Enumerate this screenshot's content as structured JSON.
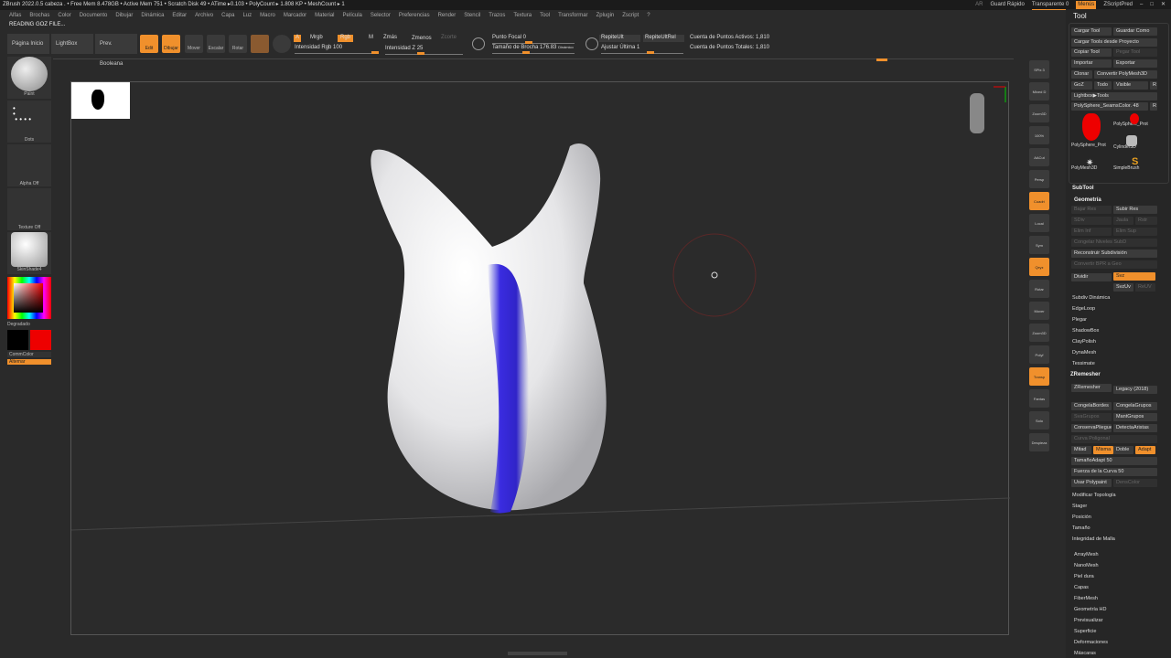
{
  "titlebar": {
    "text": "ZBrush 2022.0.5   cabeza   . • Free Mem 8.478GB • Active Mem 751 • Scratch Disk 49 •  ATime ▸0.103 • PolyCount ▸ 1.808 KP  • MeshCount ▸ 1",
    "ar": "AR",
    "quicksave": "Guard Rápido",
    "transparent": "Transparente 0",
    "menus": "Menús",
    "zscript": "ZScriptPred"
  },
  "menu": [
    "Alfas",
    "Brochas",
    "Color",
    "Documento",
    "Dibujar",
    "Dinámica",
    "Editar",
    "Archivo",
    "Capa",
    "Luz",
    "Macro",
    "Marcador",
    "Material",
    "Película",
    "Selector",
    "Preferencias",
    "Render",
    "Stencil",
    "Trazos",
    "Textura",
    "Tool",
    "Transformar",
    "Zplugin",
    "Zscript",
    "?"
  ],
  "status": "READING GOZ FILE...",
  "toolbar": {
    "home": "Página Inicio",
    "lightbox": "LightBox",
    "boolean": "Prev. Booleana",
    "edit": "Edit",
    "draw": "Dibujar",
    "move": "Mover",
    "scale": "Escalar",
    "rotate": "Rotar",
    "a": "A",
    "mrgb": "Mrgb",
    "rgb": "Rgb",
    "m": "M",
    "zadd": "Zmás",
    "zsub": "Zmenos",
    "zcut": "Zcorte",
    "rgb_intensity": "Intensidad Rgb 100",
    "z_intensity": "Intensidad Z 25",
    "focal": "Punto Focal 0",
    "draw_size": "Tamaño de Brocha 176.83",
    "dynamic": "Dinámico",
    "replay": "RepiteUlt",
    "replay_rel": "RepiteUltRel",
    "adjust": "Ajustar Última 1",
    "active_points": "Cuenta de Puntos Activos: 1,810",
    "total_points": "Cuenta de Puntos Totales: 1,810"
  },
  "leftshelf": {
    "brush": "Paint",
    "stroke": "Dots",
    "alpha": "Alpha Off",
    "texture": "Texture Off",
    "material": "SkinShade4",
    "gradient": "Degradado",
    "switch_color": "CommColor",
    "alternate": "Alternar"
  },
  "iconstrip": [
    "SPix 3",
    "Mixed D",
    "Zoom3D",
    "100%",
    "AACut",
    "Persp",
    "Cuadrí",
    "Local",
    "Sym",
    "Qxyz",
    "Rotar",
    "Mover",
    "Zoom3D",
    "Polyf",
    "Transp",
    "Fantas",
    "Solo",
    "Despieza"
  ],
  "panel": {
    "title": "Tool",
    "top": [
      "Cargar Tool",
      "Guardar Como",
      "Cargar Tools desde Proyecto",
      "Copiar Tool",
      "Pegar Tool",
      "Importar",
      "Exportar",
      "Clonar",
      "Convertir PolyMesh3D",
      "GoZ",
      "Todo",
      "Visible",
      "R",
      "Lightbox▶Tools",
      "PolySphere_SeamsColor. 48",
      "R"
    ],
    "thumbs": [
      "PolySphere_Prot",
      "PolySphere_Prot",
      "Cylinder3D",
      "PolyMesh3D",
      "SimpleBrush"
    ],
    "subtool": "SubTool",
    "geometry": "Geometría",
    "geo": [
      "Bajar Res",
      "Subir Res",
      "SDiv",
      "Jaula",
      "Rstr",
      "Elim Inf",
      "Elim Sup",
      "Congelar Niveles SubD",
      "Reconstruir Subdivisión",
      "Convertir BPR a Geo",
      "Dividir",
      "Svz",
      "SvzUv",
      "ReUV"
    ],
    "geo_items": [
      "Subdiv Dinámica",
      "EdgeLoop",
      "Plegar",
      "ShadowBox",
      "ClayPolish",
      "DynaMesh",
      "Tessimate"
    ],
    "zremesher": "ZRemesher",
    "zr": [
      "ZRemesher",
      "Legacy (2018)",
      "CongelaBordes",
      "CongelaGrupos",
      "SvaGrupos",
      "MantGrupos",
      "ConservaPliegue",
      "DetectaAristas",
      "Curva Poligonal",
      "Mitad",
      "Misma",
      "Doble",
      "Adapt",
      "TamañoAdapt 50",
      "Fuerza de la Curva 50",
      "Usar Polypaint",
      "DensColor"
    ],
    "geo_tail": [
      "Modificar Topología",
      "Stager",
      "Posición",
      "Tamaño",
      "Integridad de Malla"
    ],
    "sections": [
      "ArrayMesh",
      "NanoMesh",
      "Piel dura",
      "Capas",
      "FiberMesh",
      "Geometría HD",
      "Previsualizar",
      "Superficie",
      "Deformaciones",
      "Máscaras"
    ]
  }
}
